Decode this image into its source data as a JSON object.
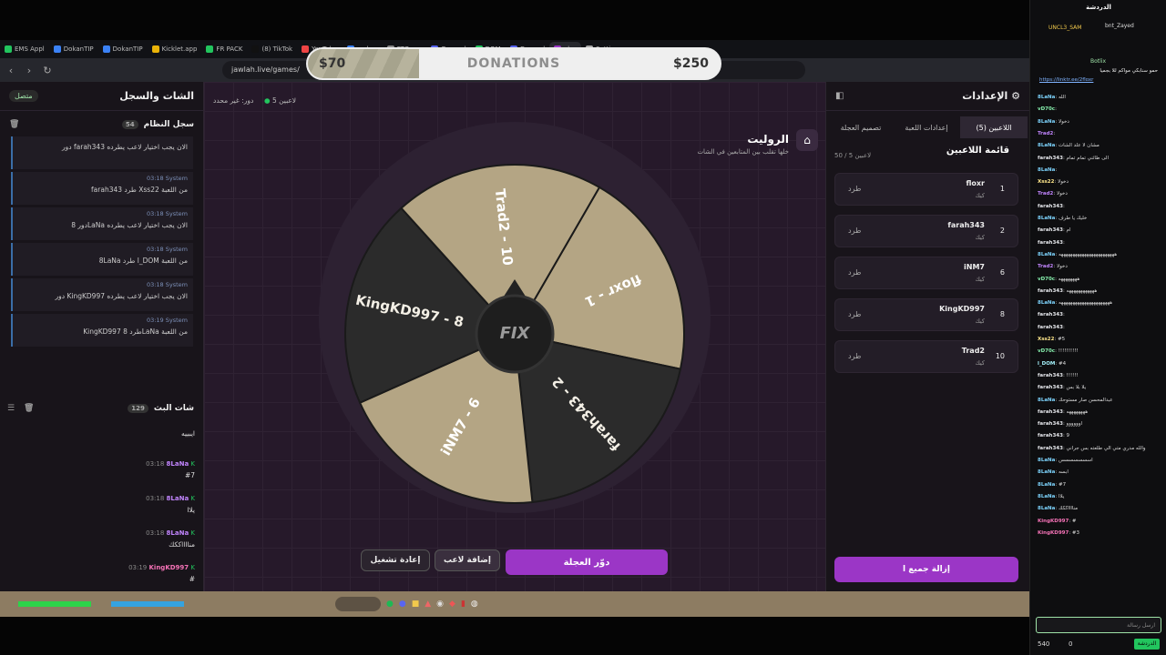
{
  "colors": {
    "accent": "#9b36c6",
    "green": "#22c55e",
    "wheel_light": "#b4a584",
    "wheel_dark": "#2b2b2b"
  },
  "browser": {
    "tabs": [
      {
        "label": "EMS Appl"
      },
      {
        "label": "DokanTIP"
      },
      {
        "label": "DokanTIP"
      },
      {
        "label": "Kicklet.app"
      },
      {
        "label": "FR PACK"
      },
      {
        "label": "(8) TikTok"
      },
      {
        "label": "YouTube"
      },
      {
        "label": "مشاهدة"
      },
      {
        "label": "FTO - ..."
      },
      {
        "label": "General"
      },
      {
        "label": "DOM"
      },
      {
        "label": "General"
      },
      {
        "label": "جولة"
      },
      {
        "label": "Settings"
      }
    ],
    "url": "jawlah.live/games/"
  },
  "donation": {
    "title": "DONATIONS",
    "min": "$70",
    "max": "$250",
    "progress": 0.27
  },
  "left": {
    "title": "الشات والسجل",
    "status": "متصل",
    "log_title": "سجل النظام",
    "log_count": "54",
    "log": [
      {
        "time": "",
        "user": "",
        "text": "دور farah343 الان يجب اختيار لاعب يطرده"
      },
      {
        "time": "03:18",
        "user": "System",
        "text": "farah343 طرد Xss22 من اللعبة"
      },
      {
        "time": "03:18",
        "user": "System",
        "text": "دور 8LaNa الان يجب اختيار لاعب يطرده"
      },
      {
        "time": "03:18",
        "user": "System",
        "text": "8LaNa طرد l_DOM من اللعبة"
      },
      {
        "time": "03:18",
        "user": "System",
        "text": "دور KingKD997 الان يجب اختيار لاعب يطرده"
      },
      {
        "time": "03:19",
        "user": "System",
        "text": "KingKD997 طرد 8LaNa من اللعبة"
      }
    ],
    "chat_title": "شات البث",
    "chat_count": "129",
    "chat": [
      {
        "time": "",
        "user": "",
        "text": "ايبييه"
      },
      {
        "time": "03:18",
        "user": "8LaNa",
        "text": "#7"
      },
      {
        "time": "03:18",
        "user": "8LaNa",
        "text": "يلاا"
      },
      {
        "time": "03:18",
        "user": "8LaNa",
        "text": "منااااككك"
      },
      {
        "time": "03:19",
        "user": "KingKD997",
        "text": "#"
      },
      {
        "time": "03:19",
        "user": "KingKD997",
        "text": "#3"
      }
    ]
  },
  "game": {
    "title": "الروليت",
    "subtitle": "خلها تقلب بين المتابعين في الشات",
    "players_count": "5 لاعبين",
    "turn": "دور: غير محدد",
    "wheel": [
      {
        "label": "floxr - 1"
      },
      {
        "label": "farah343 - 2"
      },
      {
        "label": "iNM7 - 6"
      },
      {
        "label": "KingKD997 - 8"
      },
      {
        "label": "Trad2 - 10"
      }
    ],
    "logo": "FIX",
    "spin": "دوّر العجلة",
    "add": "إضافة لاعب",
    "reset": "إعادة تشغيل"
  },
  "right": {
    "title": "الإعدادات",
    "tabs": [
      "اللاعبين (5)",
      "إعدادات اللعبة",
      "تصميم العجلة"
    ],
    "list_title": "قائمة اللاعبين",
    "list_count": "50 / 5 لاعبين",
    "players": [
      {
        "name": "floxr",
        "sub": "كيك",
        "num": "1",
        "kick": "طرد"
      },
      {
        "name": "farah343",
        "sub": "كيك",
        "num": "2",
        "kick": "طرد"
      },
      {
        "name": "iNM7",
        "sub": "كيك",
        "num": "6",
        "kick": "طرد"
      },
      {
        "name": "KingKD997",
        "sub": "كيك",
        "num": "8",
        "kick": "طرد"
      },
      {
        "name": "Trad2",
        "sub": "كيك",
        "num": "10",
        "kick": "طرد"
      }
    ],
    "remove_all": "إزالة جميع ا"
  },
  "stream_chat": {
    "header": "الدردشة",
    "pinned_user": "UNCL3_SAM",
    "pinned_user2": "bnt_Zayed",
    "bot": "Botlix",
    "bot_msg": "حمو سنابكي مواكم للا بجميا",
    "bot_link": "https://linktr.ee/2floxr",
    "lines": [
      {
        "user": "8LaNa",
        "text": "الله"
      },
      {
        "user": "vD70c",
        "text": ""
      },
      {
        "user": "8LaNa",
        "text": "دخولا"
      },
      {
        "user": "Trad2",
        "text": ""
      },
      {
        "user": "8LaNa",
        "text": "مشان لا علد الشات"
      },
      {
        "user": "farah343",
        "text": "الى طائني تمام تمام"
      },
      {
        "user": "8LaNa",
        "text": ""
      },
      {
        "user": "Xss22",
        "text": "دخولا"
      },
      {
        "user": "Trad2",
        "text": "دخولا"
      },
      {
        "user": "farah343",
        "text": ""
      },
      {
        "user": "8LaNa",
        "text": "خليك يا طرف"
      },
      {
        "user": "farah343",
        "text": "ام"
      },
      {
        "user": "farah343",
        "text": ""
      },
      {
        "user": "8LaNa",
        "text": "ههههههههههههههههههههههههه"
      },
      {
        "user": "Trad2",
        "text": "دخولا"
      },
      {
        "user": "vD70c",
        "text": "ههههههههه"
      },
      {
        "user": "farah343",
        "text": "ههههههههههههه"
      },
      {
        "user": "8LaNa",
        "text": "ههههههههههههههههههههههه"
      },
      {
        "user": "farah343",
        "text": ""
      },
      {
        "user": "farah343",
        "text": ""
      },
      {
        "user": "Xss22",
        "text": "#5"
      },
      {
        "user": "vD70c",
        "text": "!!!!!!!!!!"
      },
      {
        "user": "l_DOM",
        "text": "#4"
      },
      {
        "user": "farah343",
        "text": "!!!!!!"
      },
      {
        "user": "farah343",
        "text": "يلا بلا بس"
      },
      {
        "user": "8LaNa",
        "text": "عبدالمحسن صار مستوحك"
      },
      {
        "user": "farah343",
        "text": "ههههههههه"
      },
      {
        "user": "farah343",
        "text": "اوووووو"
      },
      {
        "user": "farah343",
        "text": "9"
      },
      {
        "user": "farah343",
        "text": "والله مدري متي الي طلعته بس جراني"
      },
      {
        "user": "8LaNa",
        "text": "اسسسسسسس"
      },
      {
        "user": "8LaNa",
        "text": "ابسه"
      },
      {
        "user": "8LaNa",
        "text": "#7"
      },
      {
        "user": "8LaNa",
        "text": "يلاا"
      },
      {
        "user": "8LaNa",
        "text": "منااااككك"
      },
      {
        "user": "KingKD997",
        "text": "#"
      },
      {
        "user": "KingKD997",
        "text": "#3"
      }
    ],
    "input_placeholder": "ارسل رسالة",
    "points": "540",
    "viewers": "0",
    "send": "الدردشة"
  }
}
